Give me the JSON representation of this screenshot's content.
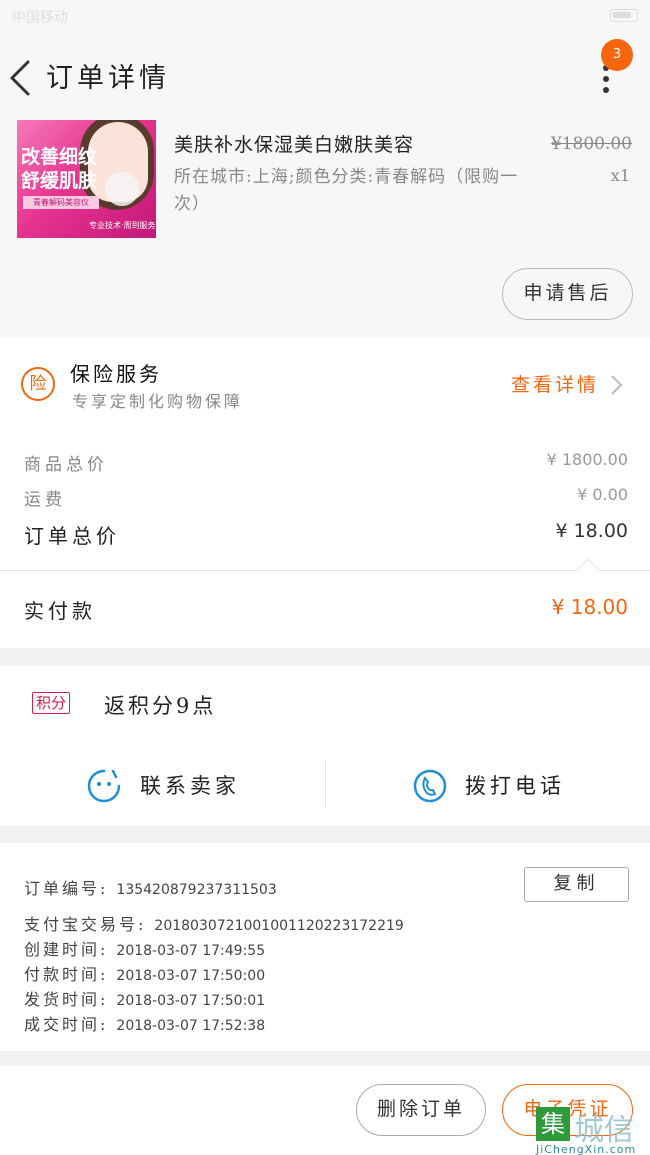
{
  "status_bar": {
    "carrier": "中国移动",
    "time": ""
  },
  "header": {
    "title": "订单详情",
    "badge_count": "3"
  },
  "product": {
    "title_line1": "美肤补水保湿美白嫩肤美容",
    "spec": "所在城市:上海;颜色分类:青春解码（限购一次）",
    "old_price": "¥1800.00",
    "quantity": "x1",
    "image_text": {
      "line1": "改善细纹",
      "line2": "舒缓肌肤",
      "line3": "青春解码美容仪",
      "line4": "专业技术·周到服务"
    },
    "after_sale_label": "申请售后"
  },
  "insurance": {
    "icon_text": "险",
    "title": "保险服务",
    "subtitle": "专享定制化购物保障",
    "link_label": "查看详情"
  },
  "prices": {
    "goods_total_label": "商品总价",
    "goods_total_value": "¥ 1800.00",
    "shipping_label": "运费",
    "shipping_value": "¥ 0.00",
    "order_total_label": "订单总价",
    "order_total_value": "¥ 18.00"
  },
  "paid": {
    "label": "实付款",
    "value": "¥ 18.00"
  },
  "points": {
    "tag": "积分",
    "text": "返积分9点"
  },
  "actions": {
    "contact_label": "联系卖家",
    "call_label": "拨打电话"
  },
  "order_info": {
    "order_no_label": "订单编号:",
    "order_no": "135420879237311503",
    "alipay_label": "支付宝交易号:",
    "alipay_no": "2018030721001001120223172219",
    "created_label": "创建时间:",
    "created": "2018-03-07 17:49:55",
    "paid_label": "付款时间:",
    "paid": "2018-03-07 17:50:00",
    "shipped_label": "发货时间:",
    "shipped": "2018-03-07 17:50:01",
    "completed_label": "成交时间:",
    "completed": "2018-03-07 17:52:38",
    "copy_label": "复制"
  },
  "footer": {
    "delete_label": "删除订单",
    "ecert_label": "电子凭证"
  },
  "watermark": {
    "box": "集",
    "text": "城信",
    "url": "JiChengXin.com"
  },
  "colors": {
    "accent": "#f5660f",
    "points_tag": "#d61d4d",
    "icon_blue": "#1e8fd6"
  }
}
